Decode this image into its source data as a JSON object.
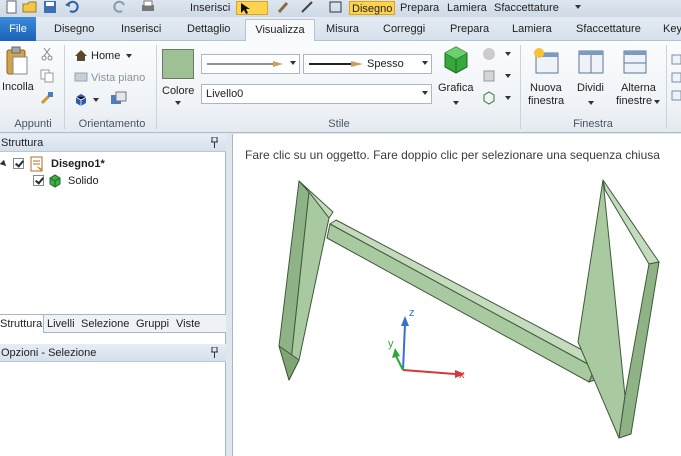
{
  "qat": {
    "inserisci": "Inserisci",
    "disegno": "Disegno",
    "prepara": "Prepara",
    "lamiera": "Lamiera",
    "sfaccettature": "Sfaccettature"
  },
  "tabs": [
    "File",
    "Disegno",
    "Inserisci",
    "Dettaglio",
    "Visualizza",
    "Misura",
    "Correggi",
    "Prepara",
    "Lamiera",
    "Sfaccettature",
    "Key"
  ],
  "ribbon": {
    "appunti": {
      "incolla": "Incolla",
      "label": "Appunti"
    },
    "orientamento": {
      "home": "Home",
      "vista_piano": "Vista piano",
      "label": "Orientamento"
    },
    "stile": {
      "colore": "Colore",
      "line_weight": "Spesso",
      "layer": "Livello0",
      "grafica": "Grafica",
      "label": "Stile",
      "swatch_color": "#9fbf94"
    },
    "finestra": {
      "nuova1": "Nuova",
      "nuova2": "finestra",
      "dividi": "Dividi",
      "alterna1": "Alterna",
      "alterna2": "finestre",
      "label": "Finestra"
    }
  },
  "struttura": {
    "title": "Struttura",
    "root": "Disegno1*",
    "child": "Solido"
  },
  "panel_tabs": [
    "Struttura",
    "Livelli",
    "Selezione",
    "Gruppi",
    "Viste"
  ],
  "opzioni": {
    "title": "Opzioni - Selezione"
  },
  "viewport": {
    "hint": "Fare clic su un oggetto. Fare doppio clic per selezionare una sequenza chiusa",
    "axis_z": "z",
    "axis_y": "y",
    "axis_x": "x",
    "solid_color": "#a9c9a0",
    "edge_color": "#3f5a3a"
  }
}
